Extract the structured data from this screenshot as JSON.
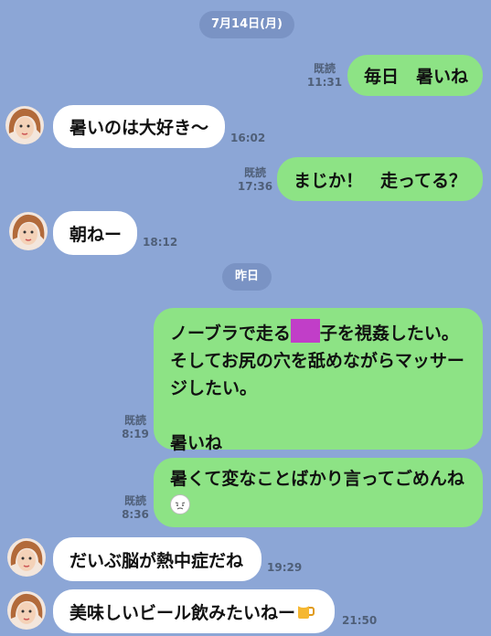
{
  "chat": {
    "date1": "7月14日(月)",
    "date2": "昨日",
    "read_label": "既読",
    "messages": [
      {
        "text": "毎日　暑いね",
        "time": "11:31"
      },
      {
        "text": "暑いのは大好き～",
        "time": "16:02"
      },
      {
        "text": "まじか！　走ってる？",
        "time": "17:36"
      },
      {
        "text": "朝ねー",
        "time": "18:12"
      },
      {
        "text_part1": "ノーブラで走る",
        "text_part2": "子を視姦したい。そしてお尻の穴を舐めながらマッサージしたい。",
        "text_part3": "暑いね",
        "time": "8:19"
      },
      {
        "text": "暑くて変なことばかり言ってごめんね",
        "time": "8:36"
      },
      {
        "text": "だいぶ脳が熱中症だね",
        "time": "19:29"
      },
      {
        "text": "美味しいビール飲みたいねー",
        "time": "21:50"
      }
    ]
  },
  "icons": {
    "avatar": "contact-avatar-icon",
    "redaction": "redaction-block",
    "emoji1": "sweat-face-emoji-icon",
    "emoji2": "beer-mug-emoji-icon"
  },
  "colors": {
    "background": "#8ca6d6",
    "incoming_bubble": "#ffffff",
    "outgoing_bubble": "#8de385",
    "date_pill": "#7a93c4"
  }
}
